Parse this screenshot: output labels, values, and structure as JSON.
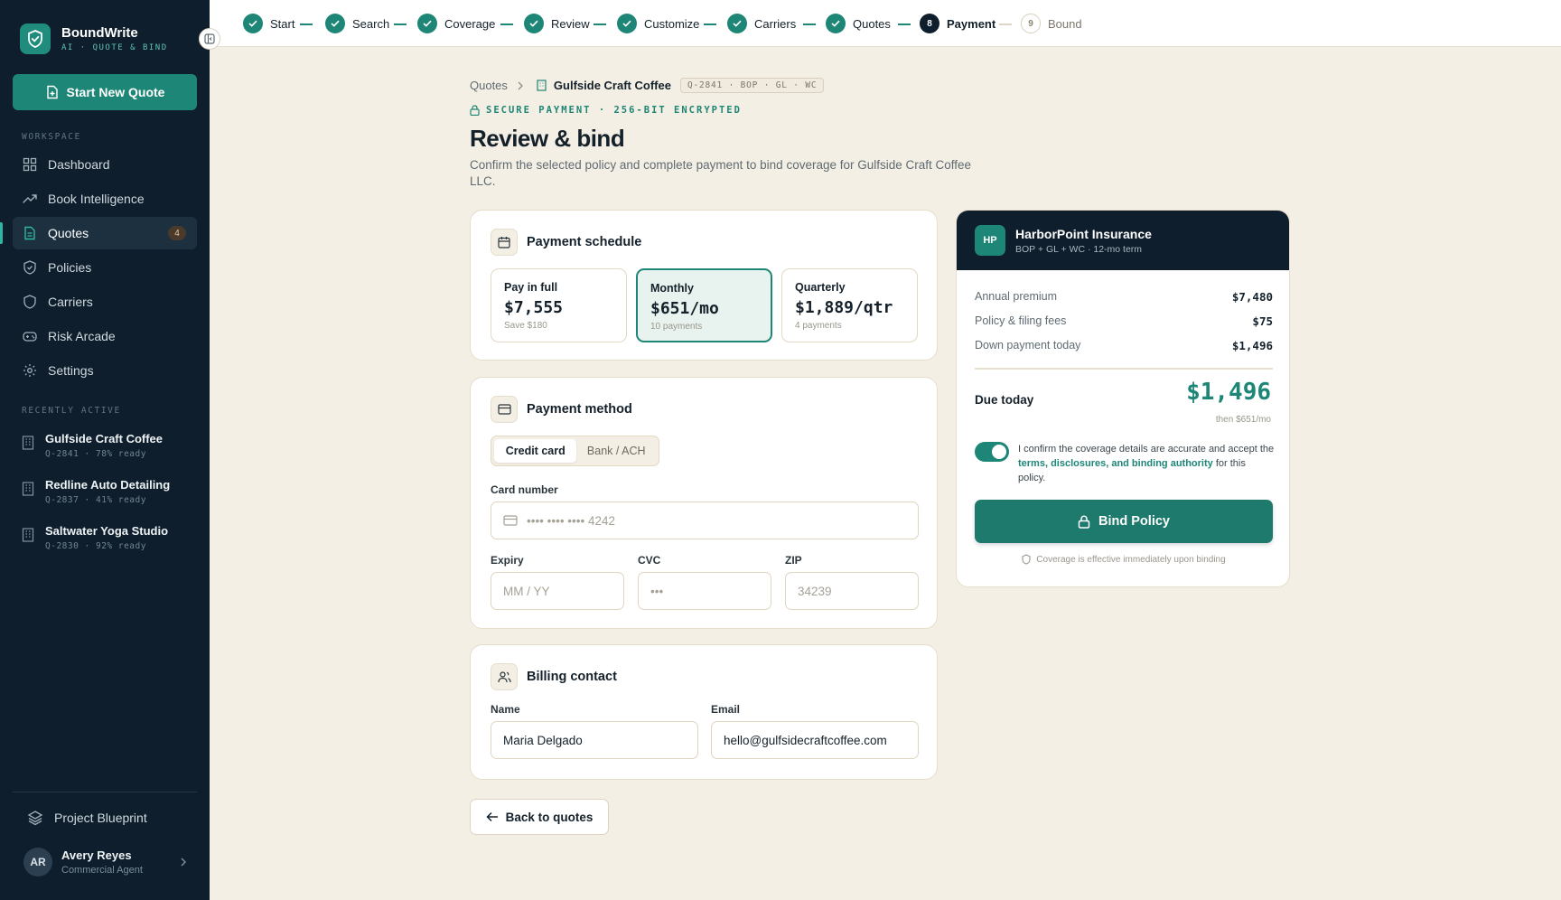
{
  "brand": {
    "name": "BoundWrite",
    "tagline": "AI · QUOTE & BIND"
  },
  "sidebar": {
    "new_quote_label": "Start New Quote",
    "workspace_label": "WORKSPACE",
    "nav": [
      {
        "label": "Dashboard",
        "icon": "grid-icon"
      },
      {
        "label": "Book Intelligence",
        "icon": "trend-icon"
      },
      {
        "label": "Quotes",
        "icon": "document-icon",
        "count": "4",
        "active": true
      },
      {
        "label": "Policies",
        "icon": "shield-icon"
      },
      {
        "label": "Carriers",
        "icon": "shield-outline-icon"
      },
      {
        "label": "Risk Arcade",
        "icon": "gamepad-icon"
      },
      {
        "label": "Settings",
        "icon": "gear-icon"
      }
    ],
    "recent_label": "RECENTLY ACTIVE",
    "recent": [
      {
        "name": "Gulfside Craft Coffee",
        "meta": "Q-2841 · 78% ready"
      },
      {
        "name": "Redline Auto Detailing",
        "meta": "Q-2837 · 41% ready"
      },
      {
        "name": "Saltwater Yoga Studio",
        "meta": "Q-2830 · 92% ready"
      }
    ],
    "blueprint_label": "Project Blueprint",
    "user": {
      "initials": "AR",
      "name": "Avery Reyes",
      "role": "Commercial Agent"
    }
  },
  "stepper": {
    "steps": [
      {
        "label": "Start",
        "state": "done"
      },
      {
        "label": "Search",
        "state": "done"
      },
      {
        "label": "Coverage",
        "state": "done"
      },
      {
        "label": "Review",
        "state": "done"
      },
      {
        "label": "Customize",
        "state": "done"
      },
      {
        "label": "Carriers",
        "state": "done"
      },
      {
        "label": "Quotes",
        "state": "done"
      },
      {
        "label": "Payment",
        "state": "current",
        "number": "8"
      },
      {
        "label": "Bound",
        "state": "future",
        "number": "9"
      }
    ]
  },
  "breadcrumb": {
    "root": "Quotes",
    "current": "Gulfside Craft Coffee",
    "tag": "Q-2841 · BOP · GL · WC"
  },
  "page": {
    "secure_label": "SECURE PAYMENT · 256-BIT ENCRYPTED",
    "title": "Review & bind",
    "subtitle": "Confirm the selected policy and complete payment to bind coverage for Gulfside Craft Coffee LLC."
  },
  "schedule": {
    "title": "Payment schedule",
    "plans": [
      {
        "name": "Pay in full",
        "price": "$7,555",
        "note": "Save $180",
        "selected": false
      },
      {
        "name": "Monthly",
        "price": "$651/mo",
        "note": "10 payments",
        "selected": true
      },
      {
        "name": "Quarterly",
        "price": "$1,889/qtr",
        "note": "4 payments",
        "selected": false
      }
    ]
  },
  "method": {
    "title": "Payment method",
    "tabs": [
      "Credit card",
      "Bank / ACH"
    ],
    "active_tab": "Credit card",
    "card_number_label": "Card number",
    "card_number_placeholder": "•••• •••• •••• 4242",
    "expiry_label": "Expiry",
    "expiry_placeholder": "MM / YY",
    "cvc_label": "CVC",
    "cvc_placeholder": "•••",
    "zip_label": "ZIP",
    "zip_placeholder": "34239"
  },
  "billing": {
    "title": "Billing contact",
    "name_label": "Name",
    "name_value": "Maria Delgado",
    "email_label": "Email",
    "email_value": "hello@gulfsidecraftcoffee.com"
  },
  "back_label": "Back to quotes",
  "summary": {
    "carrier_initials": "HP",
    "carrier_name": "HarborPoint Insurance",
    "carrier_meta": "BOP + GL + WC · 12-mo term",
    "lines": [
      {
        "label": "Annual premium",
        "value": "$7,480"
      },
      {
        "label": "Policy & filing fees",
        "value": "$75"
      },
      {
        "label": "Down payment today",
        "value": "$1,496"
      }
    ],
    "due_label": "Due today",
    "due_amount": "$1,496",
    "due_sub": "then $651/mo",
    "consent_on": true,
    "confirm_pre": "I confirm the coverage details are accurate and accept the ",
    "confirm_link": "terms, disclosures, and binding authority",
    "confirm_post": " for this policy.",
    "bind_label": "Bind Policy",
    "effective_note": "Coverage is effective immediately upon binding"
  },
  "colors": {
    "accent": "#1e8677",
    "sidebar": "#0f1e2c",
    "background": "#f4efe4"
  }
}
